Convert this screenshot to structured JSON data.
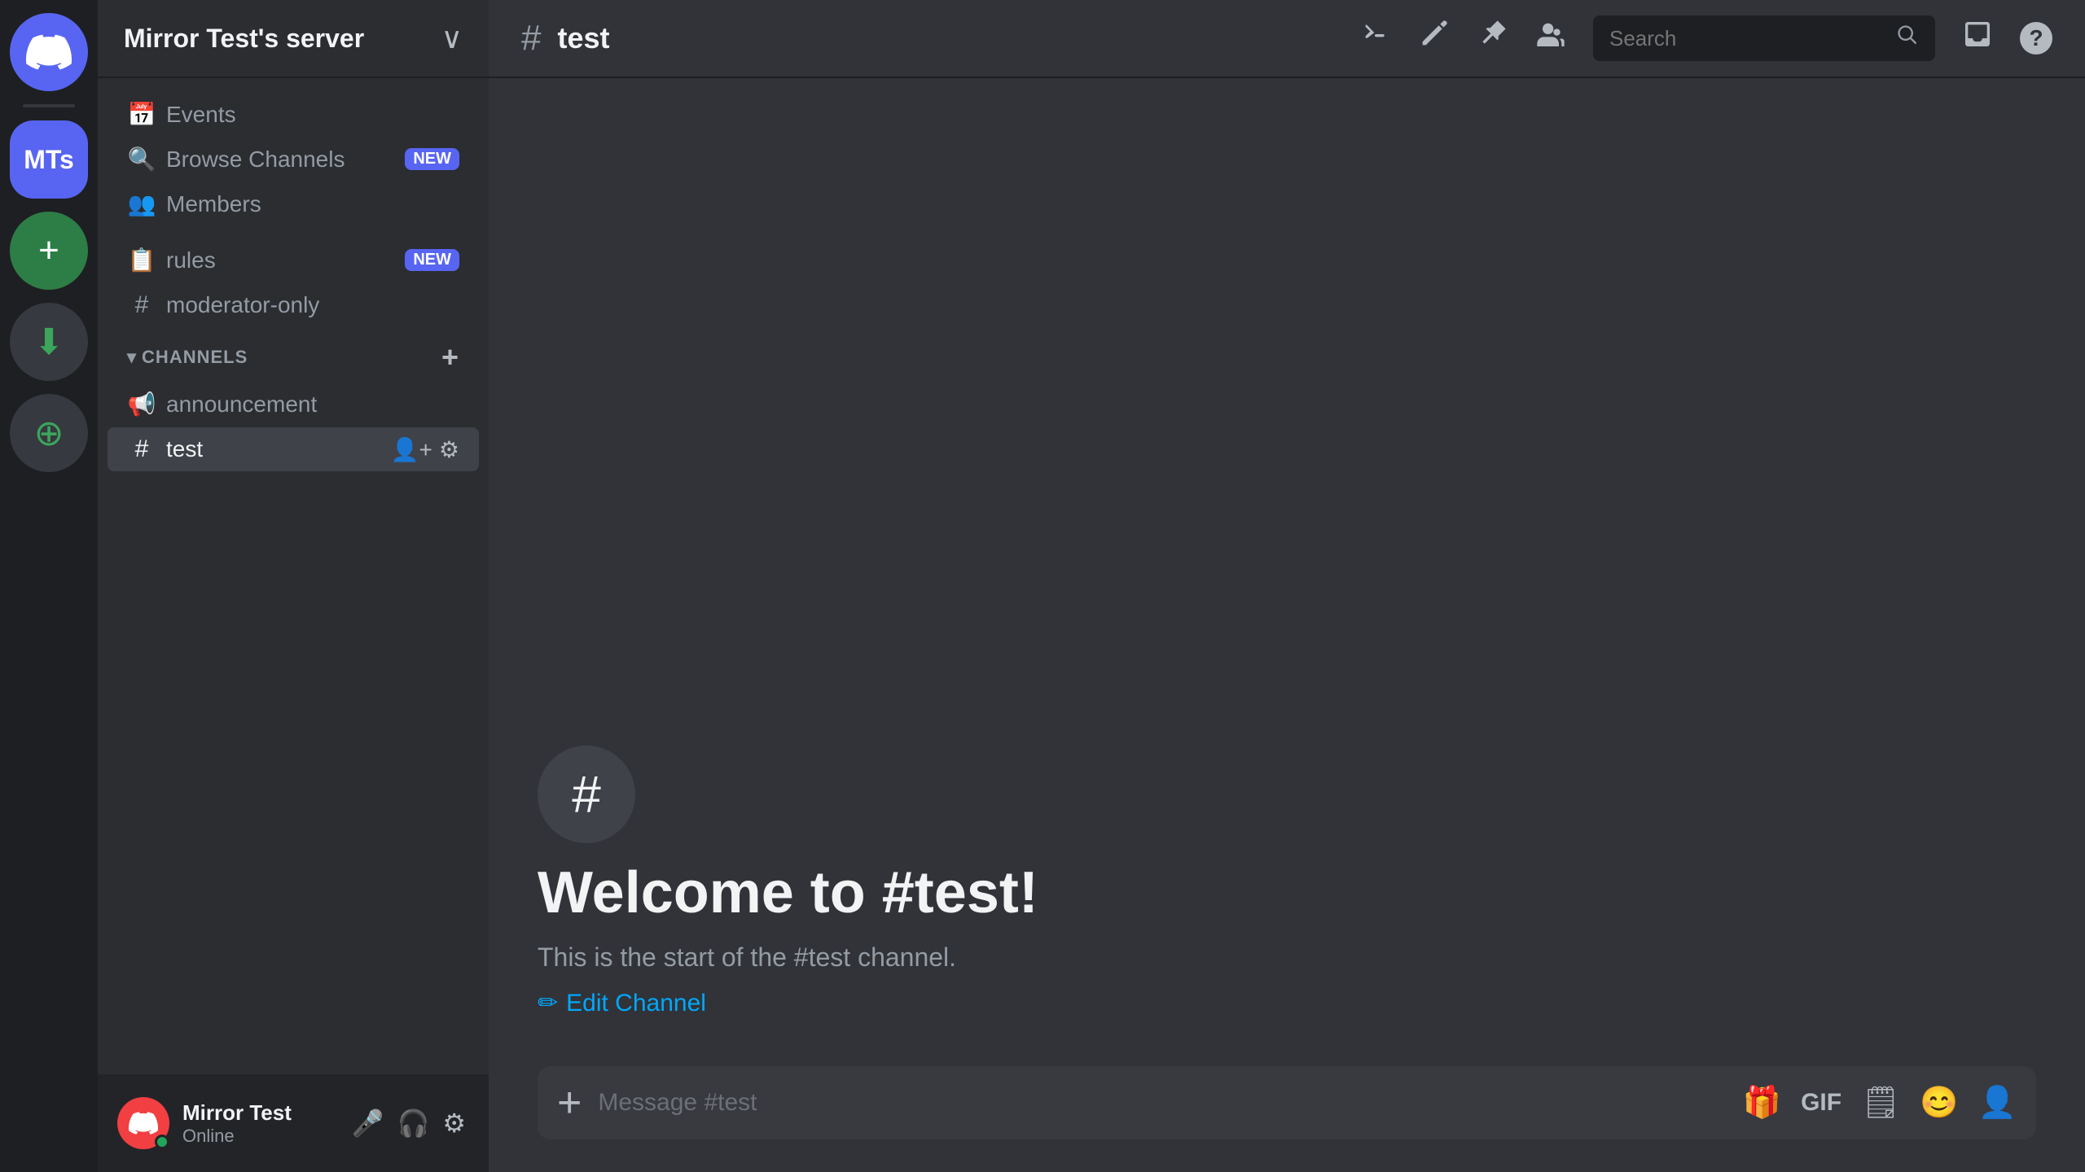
{
  "app": {
    "discord_logo": "d",
    "server_initials": "MTs"
  },
  "server": {
    "name": "Mirror Test's server",
    "chevron": "∨"
  },
  "sidebar": {
    "menu_items": [
      {
        "id": "events",
        "label": "Events",
        "icon": "📅"
      },
      {
        "id": "browse-channels",
        "label": "Browse Channels",
        "icon": "🔍",
        "badge": "NEW"
      },
      {
        "id": "members",
        "label": "Members",
        "icon": "👥"
      }
    ],
    "extra_channels": [
      {
        "id": "rules",
        "label": "rules",
        "icon": "📋",
        "badge": "NEW"
      },
      {
        "id": "moderator-only",
        "label": "moderator-only",
        "icon": "#"
      }
    ],
    "channels_section_label": "CHANNELS",
    "channels": [
      {
        "id": "announcement",
        "label": "announcement",
        "icon": "📢",
        "active": false
      },
      {
        "id": "test",
        "label": "test",
        "icon": "#",
        "active": true
      }
    ]
  },
  "channel": {
    "name": "test",
    "icon": "#"
  },
  "toolbar": {
    "items": [
      {
        "id": "threads-icon",
        "symbol": "✦"
      },
      {
        "id": "edit-icon",
        "symbol": "✏"
      },
      {
        "id": "pin-icon",
        "symbol": "📌"
      },
      {
        "id": "members-icon",
        "symbol": "👥"
      }
    ],
    "search_placeholder": "Search",
    "inbox_icon": "📥",
    "help_icon": "?"
  },
  "welcome": {
    "icon": "#",
    "title": "Welcome to #test!",
    "description": "This is the start of the #test channel.",
    "edit_channel_label": "Edit Channel"
  },
  "message_input": {
    "placeholder": "Message #test"
  },
  "user": {
    "name": "Mirror Test",
    "status": "Online",
    "avatar_text": ""
  },
  "message_toolbar_icons": [
    {
      "id": "gift-icon",
      "symbol": "🎁"
    },
    {
      "id": "gif-icon",
      "symbol": "GIF"
    },
    {
      "id": "sticker-icon",
      "symbol": "🗒"
    },
    {
      "id": "emoji-icon",
      "symbol": "😊"
    },
    {
      "id": "people-icon",
      "symbol": "👤"
    }
  ]
}
